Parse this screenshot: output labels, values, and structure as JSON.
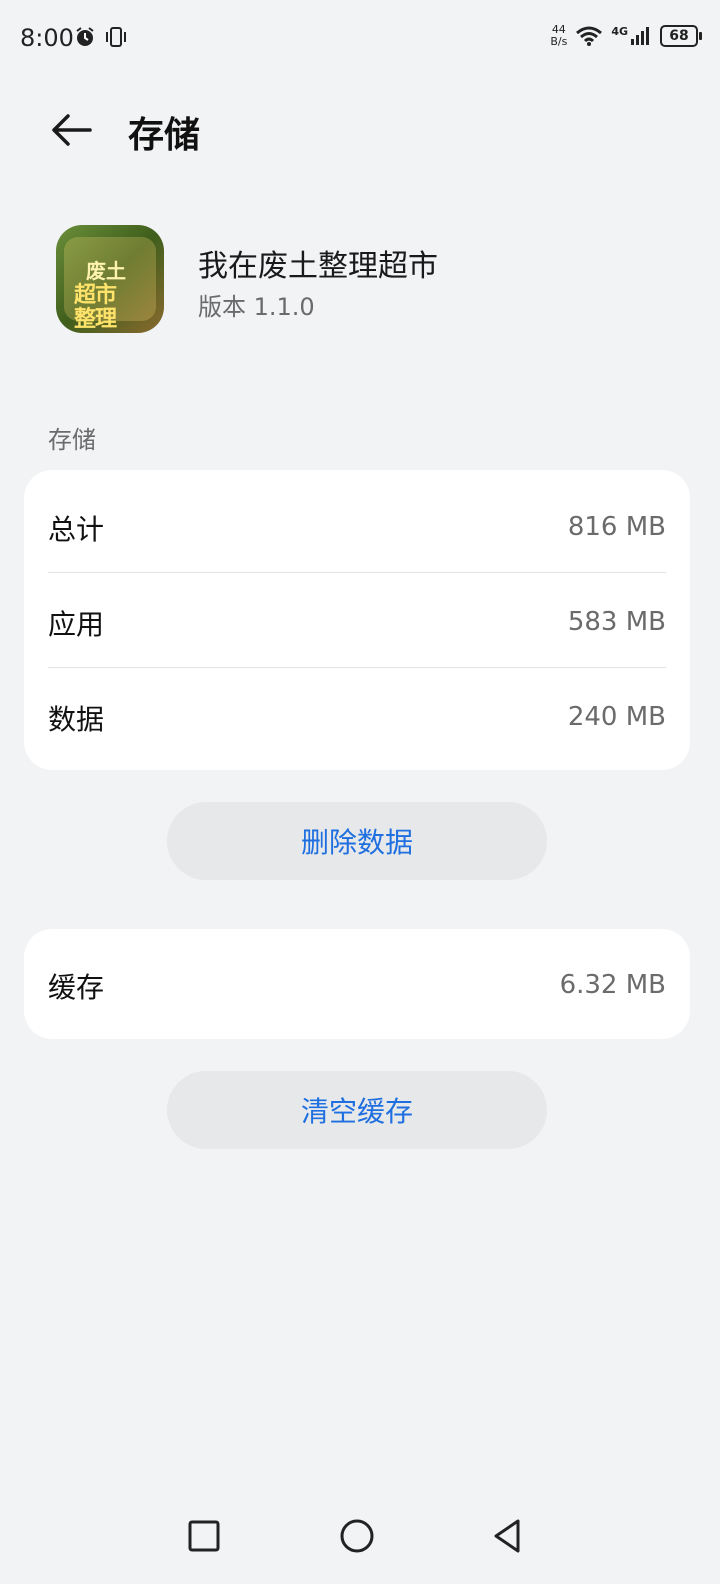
{
  "status_bar": {
    "time": "8:00",
    "net_speed_top": "44",
    "net_speed_bottom": "B/s",
    "network": "4G",
    "battery": "68"
  },
  "header": {
    "title": "存储"
  },
  "app": {
    "name": "我在废土整理超市",
    "version": "版本 1.1.0",
    "icon_text_1": "废土",
    "icon_text_2": "超市",
    "icon_text_3": "整理"
  },
  "storage_section": {
    "label": "存储",
    "rows": [
      {
        "key": "总计",
        "value": "816 MB"
      },
      {
        "key": "应用",
        "value": "583 MB"
      },
      {
        "key": "数据",
        "value": "240 MB"
      }
    ],
    "delete_button": "删除数据"
  },
  "cache_section": {
    "key": "缓存",
    "value": "6.32 MB",
    "clear_button": "清空缓存"
  },
  "colors": {
    "accent": "#1f6fe0",
    "background": "#f1f3f5",
    "card": "#ffffff"
  }
}
